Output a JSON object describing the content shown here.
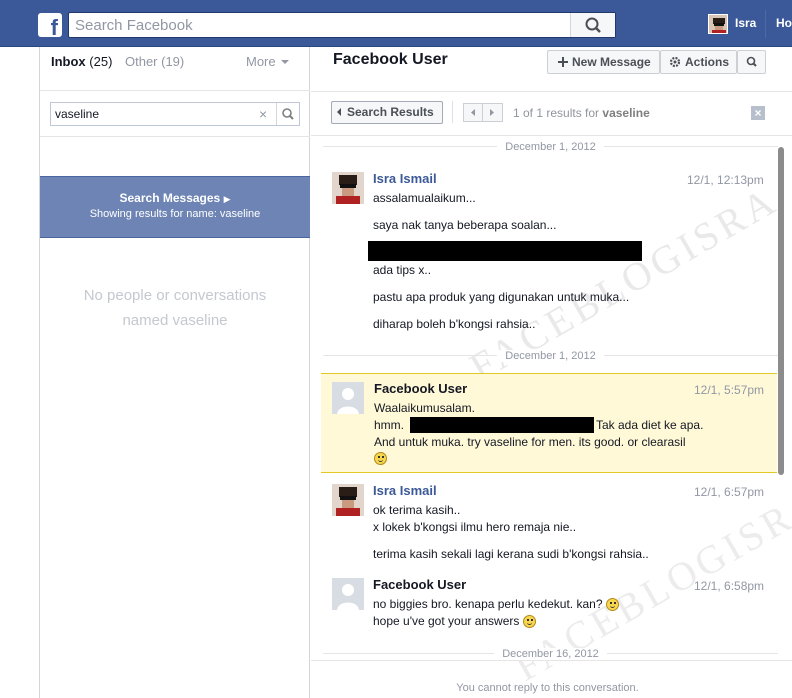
{
  "topbar": {
    "search_placeholder": "Search Facebook",
    "user_name": "Isra",
    "home_label": "Ho"
  },
  "inbox": {
    "tab_inbox_label": "Inbox",
    "tab_inbox_count": "(25)",
    "tab_other_label": "Other (19)",
    "more_label": "More",
    "search_value": "vaseline",
    "search_banner_title": "Search Messages",
    "search_banner_sub": "Showing results for name: vaseline",
    "no_results_line1": "No people or conversations",
    "no_results_line2": "named vaseline"
  },
  "conversation": {
    "title": "Facebook User",
    "new_message_label": "New Message",
    "actions_label": "Actions",
    "search_results_label": "Search Results",
    "results_count_prefix": "1 of 1 results for",
    "results_query": "vaseline",
    "cannot_reply": "You cannot reply to this conversation."
  },
  "thread": {
    "date1": "December 1, 2012",
    "date2": "December 1, 2012",
    "date3": "December 16, 2012",
    "m1": {
      "sender": "Isra Ismail",
      "time": "12/1, 12:13pm",
      "lines": [
        "assalamualaikum...",
        "saya nak tanya beberapa soalan...",
        "ada tips x..",
        "pastu apa produk yang digunakan untuk muka...",
        "diharap boleh b'kongsi rahsia.."
      ]
    },
    "m2": {
      "sender": "Facebook User",
      "time": "12/1, 5:57pm",
      "line1": "Waalaikumusalam.",
      "line2a": "hmm.",
      "line2b": "Tak ada diet ke apa.",
      "line3": "And untuk muka. try vaseline for men. its good. or clearasil"
    },
    "m3": {
      "sender": "Isra Ismail",
      "time": "12/1, 6:57pm",
      "lines": [
        "ok terima kasih..",
        " x lokek b'kongsi ilmu hero remaja nie..",
        "terima kasih sekali lagi kerana sudi b'kongsi rahsia.."
      ]
    },
    "m4": {
      "sender": "Facebook User",
      "time": "12/1, 6:58pm",
      "line1": "no biggies bro. kenapa perlu kedekut. kan?",
      "line2": "hope u've got your answers"
    }
  },
  "watermark": "FACEBLOGISRA",
  "colors": {
    "facebook_blue": "#3b5998",
    "banner_blue": "#6d84b4",
    "highlight_yellow": "#fff9d7"
  }
}
